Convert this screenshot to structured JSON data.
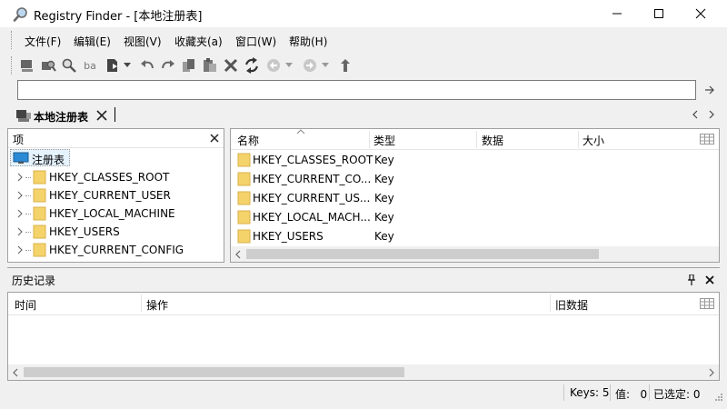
{
  "window": {
    "title": "Registry Finder - [本地注册表]"
  },
  "menu": {
    "items": [
      {
        "label": "文件(F)"
      },
      {
        "label": "编辑(E)"
      },
      {
        "label": "视图(V)"
      },
      {
        "label": "收藏夹(a)"
      },
      {
        "label": "窗口(W)"
      },
      {
        "label": "帮助(H)"
      }
    ]
  },
  "toolbar": {
    "text_tool_label": "ba"
  },
  "address": {
    "value": ""
  },
  "tabs": [
    {
      "label": "本地注册表"
    }
  ],
  "tree": {
    "header": "项",
    "root_label": "注册表",
    "items": [
      {
        "label": "HKEY_CLASSES_ROOT"
      },
      {
        "label": "HKEY_CURRENT_USER"
      },
      {
        "label": "HKEY_LOCAL_MACHINE"
      },
      {
        "label": "HKEY_USERS"
      },
      {
        "label": "HKEY_CURRENT_CONFIG"
      }
    ]
  },
  "list": {
    "columns": [
      {
        "label": "名称"
      },
      {
        "label": "类型"
      },
      {
        "label": "数据"
      },
      {
        "label": "大小"
      }
    ],
    "rows": [
      {
        "name": "HKEY_CLASSES_ROOT",
        "type": "Key"
      },
      {
        "name": "HKEY_CURRENT_CO...",
        "type": "Key"
      },
      {
        "name": "HKEY_CURRENT_US...",
        "type": "Key"
      },
      {
        "name": "HKEY_LOCAL_MACH...",
        "type": "Key"
      },
      {
        "name": "HKEY_USERS",
        "type": "Key"
      }
    ]
  },
  "history": {
    "title": "历史记录",
    "columns": [
      {
        "label": "时间"
      },
      {
        "label": "操作"
      },
      {
        "label": "旧数据"
      }
    ]
  },
  "status": {
    "keys": "Keys: 5",
    "values": "值:   0",
    "selected": "已选定: 0"
  },
  "colors": {
    "folder": "#f5d36b",
    "folder_edge": "#d9b14a",
    "icon_gray": "#5a5a5a",
    "selection": "#e5f3ff",
    "scroll_thumb": "#cdcdcd"
  }
}
